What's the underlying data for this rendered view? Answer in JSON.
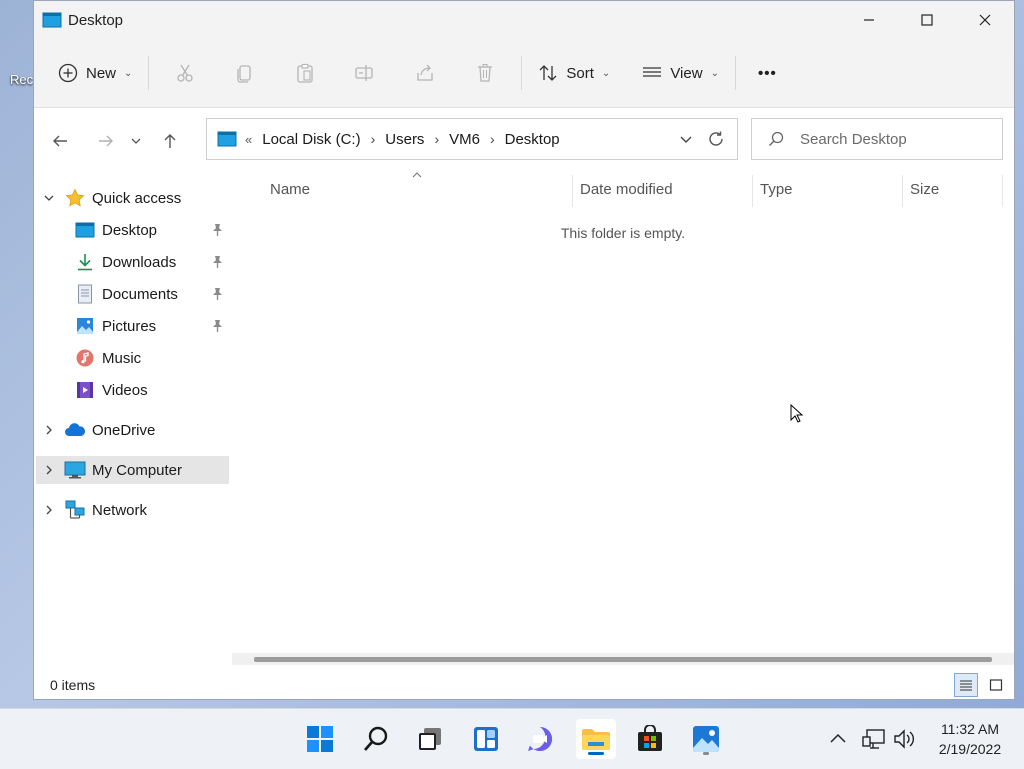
{
  "desktop": {
    "partial_label": "Rec"
  },
  "window": {
    "title": "Desktop",
    "controls": {
      "minimize": "minimize",
      "maximize": "maximize",
      "close": "close"
    }
  },
  "toolbar": {
    "new_label": "New",
    "sort_label": "Sort",
    "view_label": "View",
    "more_label": "•••",
    "chevron": "⌄"
  },
  "address": {
    "overflow": "«",
    "crumbs": [
      "Local Disk (C:)",
      "Users",
      "VM6",
      "Desktop"
    ],
    "separator": "›"
  },
  "search": {
    "placeholder": "Search Desktop"
  },
  "nav": {
    "quick_access": "Quick access",
    "pinned": [
      "Desktop",
      "Downloads",
      "Documents",
      "Pictures"
    ],
    "unpinned": [
      "Music",
      "Videos"
    ],
    "onedrive": "OneDrive",
    "my_computer": "My Computer",
    "network": "Network"
  },
  "columns": {
    "name": "Name",
    "date_modified": "Date modified",
    "type": "Type",
    "size": "Size"
  },
  "content": {
    "empty_message": "This folder is empty."
  },
  "status": {
    "items": "0 items"
  },
  "taskbar": {
    "time": "11:32 AM",
    "date": "2/19/2022"
  },
  "colors": {
    "accent": "#0067c0",
    "folder": "#f5c04a",
    "selection": "#e5e5e5"
  }
}
